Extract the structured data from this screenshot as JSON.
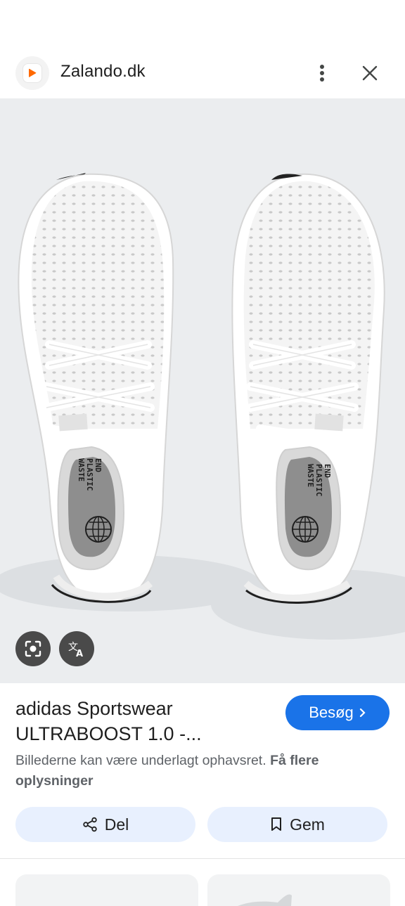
{
  "header": {
    "site_name": "Zalando.dk",
    "favicon_icon": "zalando-play-logo",
    "menu_icon": "more-vert-icon",
    "close_icon": "close-icon",
    "brand_color": "#ff6900"
  },
  "image": {
    "description_icons": [
      "lens-icon",
      "translate-icon"
    ],
    "insole_text": [
      "END",
      "PLASTIC",
      "WASTE"
    ]
  },
  "result": {
    "title_line1": "adidas Sportswear",
    "title_line2": "ULTRABOOST 1.0 -...",
    "visit_label": "Besøg",
    "visit_chevron": "›",
    "copyright_text": "Billederne kan være underlagt ophavsret.",
    "more_info_link": "Få flere oplysninger",
    "share_label": "Del",
    "save_label": "Gem",
    "accent_color": "#1a73e8"
  }
}
